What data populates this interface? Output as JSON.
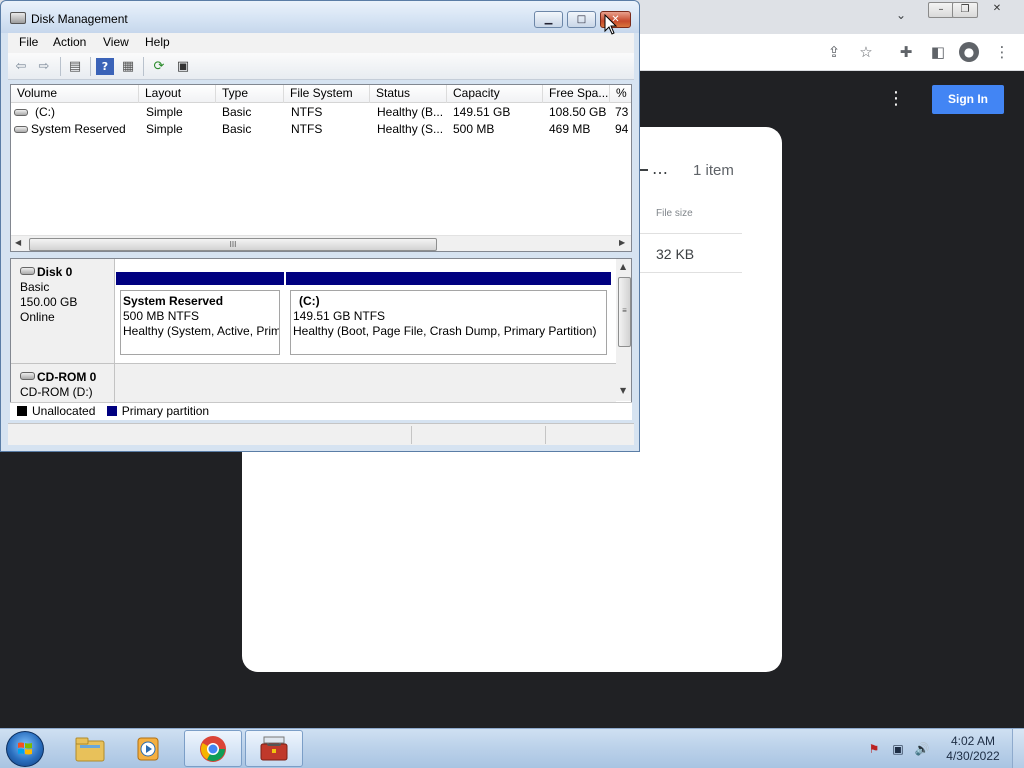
{
  "window": {
    "title": "Disk Management",
    "buttons": {
      "minimize": "▁",
      "maximize": "□",
      "close": "✕"
    }
  },
  "menu": [
    "File",
    "Action",
    "View",
    "Help"
  ],
  "toolbar_icons": [
    "back-arrow-icon",
    "forward-arrow-icon",
    "console-tree-icon",
    "help-icon",
    "properties-icon",
    "refresh-icon",
    "rescan-icon"
  ],
  "volume_list": {
    "columns": [
      "Volume",
      "Layout",
      "Type",
      "File System",
      "Status",
      "Capacity",
      "Free Spa...",
      "% F"
    ],
    "rows": [
      [
        "(C:)",
        "Simple",
        "Basic",
        "NTFS",
        "Healthy (B...",
        "149.51 GB",
        "108.50 GB",
        "73"
      ],
      [
        "System Reserved",
        "Simple",
        "Basic",
        "NTFS",
        "Healthy (S...",
        "500 MB",
        "469 MB",
        "94"
      ]
    ],
    "hscroll_grip": "III"
  },
  "disks": {
    "disk0": {
      "name": "Disk 0",
      "type": "Basic",
      "size": "150.00 GB",
      "state": "Online"
    },
    "cdrom0": {
      "name": "CD-ROM 0",
      "drive": "CD-ROM (D:)"
    }
  },
  "partitions": {
    "system_reserved": {
      "name": "System Reserved",
      "size": "500 MB NTFS",
      "status": "Healthy (System, Active, Prim"
    },
    "c": {
      "name": "(C:)",
      "size": "149.51 GB NTFS",
      "status": "Healthy (Boot, Page File, Crash Dump, Primary Partition)"
    }
  },
  "legend": {
    "unallocated": "Unallocated",
    "primary": "Primary partition",
    "colors": {
      "unallocated": "#000000",
      "primary": "#000080"
    }
  },
  "browser": {
    "sign_in": "Sign In",
    "item_count": "1 item",
    "file_size_label": "File size",
    "file_size": "32 KB",
    "more": "⋮",
    "accent": "#4285f4"
  },
  "taskbar": {
    "time": "4:02 AM",
    "date": "4/30/2022"
  }
}
